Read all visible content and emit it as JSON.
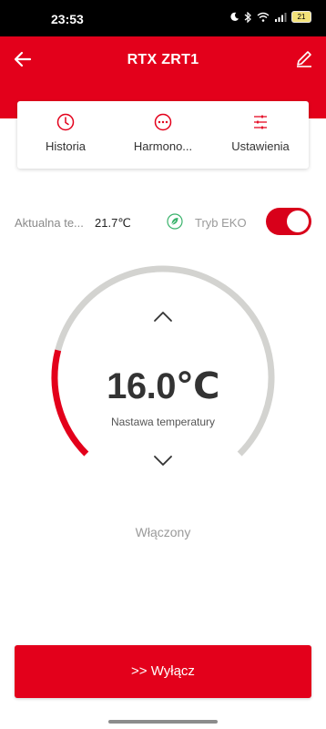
{
  "status_bar": {
    "time": "23:53",
    "battery": "21"
  },
  "header": {
    "title": "RTX ZRT1",
    "background": "#e3001b"
  },
  "menu": {
    "items": [
      {
        "label": "Historia",
        "icon": "clock-icon"
      },
      {
        "label": "Harmono...",
        "icon": "dots-circle-icon"
      },
      {
        "label": "Ustawienia",
        "icon": "settings-sliders-icon"
      }
    ]
  },
  "current": {
    "label": "Aktualna te...",
    "value": "21.7℃"
  },
  "eco": {
    "label": "Tryb EKO",
    "enabled": true
  },
  "thermostat": {
    "setpoint": "16.0℃",
    "setpoint_label": "Nastawa temperatury",
    "arc_fraction": 0.22,
    "accent": "#e3001b",
    "track": "#d3d3d0"
  },
  "status": "Włączony",
  "power_button": {
    "label": ">> Wyłącz"
  }
}
